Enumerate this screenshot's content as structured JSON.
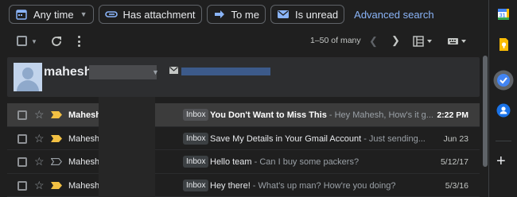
{
  "filters": {
    "any_time": "Any time",
    "has_attachment": "Has attachment",
    "to_me": "To me",
    "is_unread": "Is unread",
    "advanced_search": "Advanced search"
  },
  "toolbar": {
    "page_count": "1–50 of many"
  },
  "contact": {
    "name": "mahesh"
  },
  "emails": [
    {
      "sender": "Mahesh",
      "tag": "Inbox",
      "subject": "You Don't Want to Miss This",
      "snippet": " - Hey Mahesh, How's it g...",
      "date": "2:22 PM",
      "unread": true
    },
    {
      "sender": "Mahesh",
      "tag": "Inbox",
      "subject": "Save My Details in Your Gmail Account",
      "snippet": " - Just sending...",
      "date": "Jun 23",
      "unread": false
    },
    {
      "sender": "Mahesh",
      "tag": "Inbox",
      "subject": "Hello team",
      "snippet": " - Can I buy some packers?",
      "date": "5/12/17",
      "unread": false
    },
    {
      "sender": "Mahesh",
      "tag": "Inbox",
      "subject": "Hey there!",
      "snippet": " - What's up man? How're you doing?",
      "date": "5/3/16",
      "unread": false
    }
  ],
  "colors": {
    "background": "#1f1f1f",
    "accent_link": "#8ab4f8",
    "importance_marker": "#f2c043",
    "chip_icon": "#8ab4f8"
  },
  "icons": {
    "any_time": "calendar-icon",
    "has_attachment": "paperclip-icon",
    "to_me": "arrow-right-icon",
    "is_unread": "envelope-icon",
    "side_panel": [
      "google-calendar-icon",
      "google-keep-icon",
      "google-tasks-icon",
      "google-contacts-icon",
      "add-icon"
    ]
  }
}
